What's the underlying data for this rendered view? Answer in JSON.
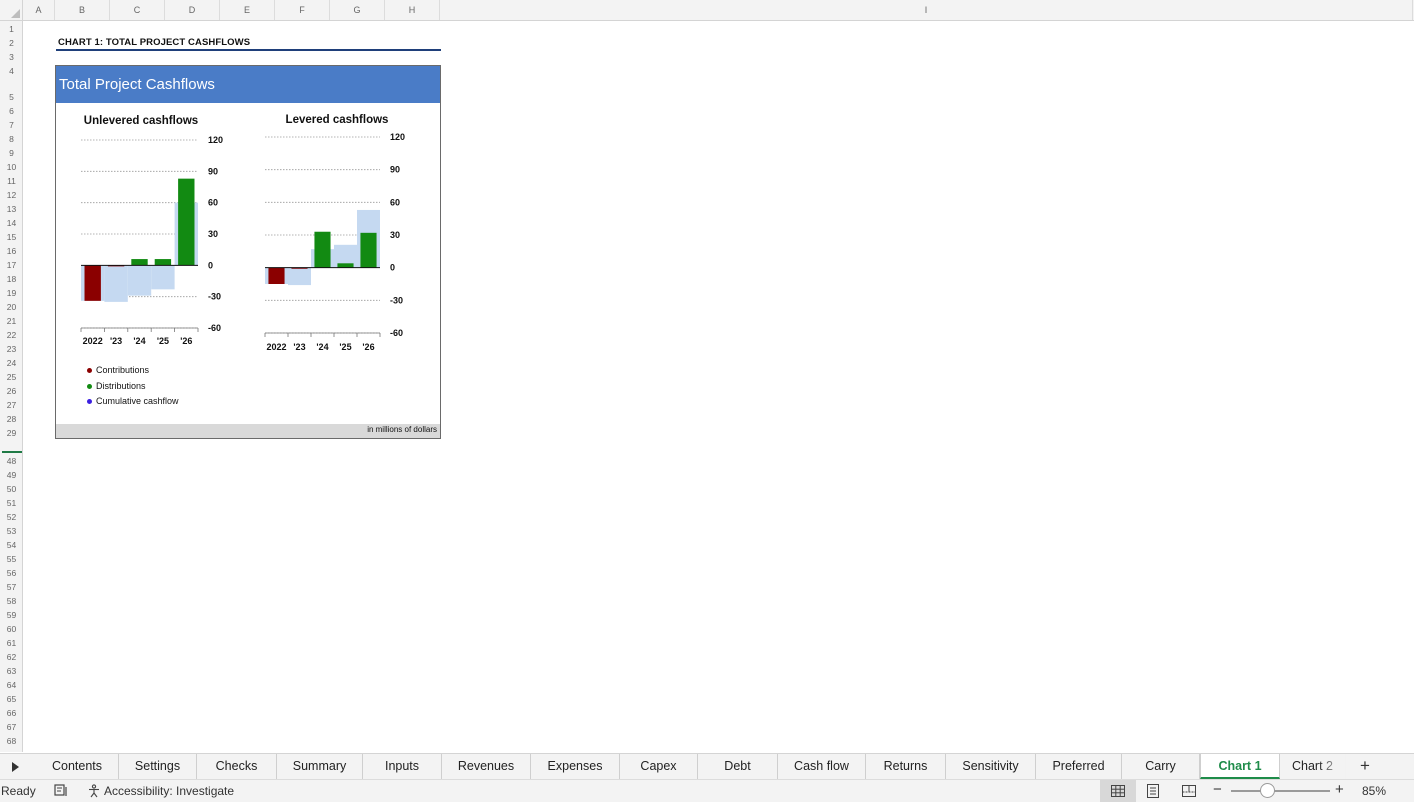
{
  "columns": [
    {
      "label": "A",
      "w": 0
    },
    {
      "label": "B",
      "w": 0
    },
    {
      "label": "C",
      "w": 0
    },
    {
      "label": "D",
      "w": 0
    },
    {
      "label": "E",
      "w": 0
    },
    {
      "label": "F",
      "w": 0
    },
    {
      "label": "G",
      "w": 0
    },
    {
      "label": "H",
      "w": 0
    },
    {
      "label": "I",
      "w": 0
    }
  ],
  "rows_top": [
    "1",
    "2",
    "3",
    "4",
    "5",
    "6",
    "7",
    "8",
    "9",
    "10",
    "11",
    "12",
    "13",
    "14",
    "15",
    "16",
    "17",
    "18",
    "19",
    "20",
    "21",
    "22",
    "23",
    "24",
    "25",
    "26",
    "27",
    "28",
    "29"
  ],
  "rows_bottom": [
    "48",
    "49",
    "50",
    "51",
    "52",
    "53",
    "54",
    "55",
    "56",
    "57",
    "58",
    "59",
    "60",
    "61",
    "62",
    "63",
    "64",
    "65",
    "66",
    "67",
    "68"
  ],
  "sheet": {
    "heading": "CHART 1: TOTAL PROJECT CASHFLOWS",
    "chart_title": "Total Project Cashflows",
    "footer_note": "in millions of dollars",
    "legend": [
      {
        "label": "Contributions",
        "color": "#8b0000"
      },
      {
        "label": "Distributions",
        "color": "#128a12"
      },
      {
        "label": "Cumulative cashflow",
        "color": "#3b1fe0"
      }
    ]
  },
  "chart_data": [
    {
      "type": "bar",
      "title": "Unlevered cashflows",
      "categories": [
        "2022",
        "'23",
        "'24",
        "'25",
        "'26"
      ],
      "ylim": [
        -60,
        120
      ],
      "yticks": [
        "120",
        "90",
        "60",
        "30",
        "0",
        "-30",
        "-60"
      ],
      "y_axis_side": "right",
      "grid": true,
      "series": [
        {
          "name": "Contributions",
          "color": "#8b0000",
          "values": [
            -34,
            -1,
            0,
            0,
            0
          ]
        },
        {
          "name": "Distributions",
          "color": "#128a12",
          "values": [
            0,
            0,
            6,
            6,
            83
          ]
        },
        {
          "name": "Cumulative cashflow",
          "color": "#c5d9f1",
          "values": [
            -34,
            -35,
            -29,
            -23,
            60
          ]
        }
      ]
    },
    {
      "type": "bar",
      "title": "Levered cashflows",
      "categories": [
        "2022",
        "'23",
        "'24",
        "'25",
        "'26"
      ],
      "ylim": [
        -60,
        120
      ],
      "yticks": [
        "120",
        "90",
        "60",
        "30",
        "0",
        "-30",
        "-60"
      ],
      "y_axis_side": "right",
      "grid": true,
      "series": [
        {
          "name": "Contributions",
          "color": "#8b0000",
          "values": [
            -15,
            -1,
            0,
            0,
            0
          ]
        },
        {
          "name": "Distributions",
          "color": "#128a12",
          "values": [
            0,
            0,
            33,
            4,
            32
          ]
        },
        {
          "name": "Cumulative cashflow",
          "color": "#c5d9f1",
          "values": [
            -15,
            -16,
            17,
            21,
            53
          ]
        }
      ]
    }
  ],
  "tabs": [
    {
      "label": "Contents",
      "active": false
    },
    {
      "label": "Settings",
      "active": false
    },
    {
      "label": "Checks",
      "active": false
    },
    {
      "label": "Summary",
      "active": false
    },
    {
      "label": "Inputs",
      "active": false
    },
    {
      "label": "Revenues",
      "active": false
    },
    {
      "label": "Expenses",
      "active": false
    },
    {
      "label": "Capex",
      "active": false
    },
    {
      "label": "Debt",
      "active": false
    },
    {
      "label": "Cash flow",
      "active": false
    },
    {
      "label": "Returns",
      "active": false
    },
    {
      "label": "Sensitivity",
      "active": false
    },
    {
      "label": "Preferred",
      "active": false
    },
    {
      "label": "Carry",
      "active": false
    },
    {
      "label": "Chart 1",
      "active": true
    },
    {
      "label": "Chart 2",
      "active": false
    }
  ],
  "status": {
    "ready": "Ready",
    "accessibility": "Accessibility: Investigate",
    "zoom": "85%",
    "zoom_fraction": 0.37
  },
  "icons": {
    "add_sheet": "plus-icon",
    "zoom_minus": "minus-icon",
    "zoom_plus": "plus-icon"
  }
}
